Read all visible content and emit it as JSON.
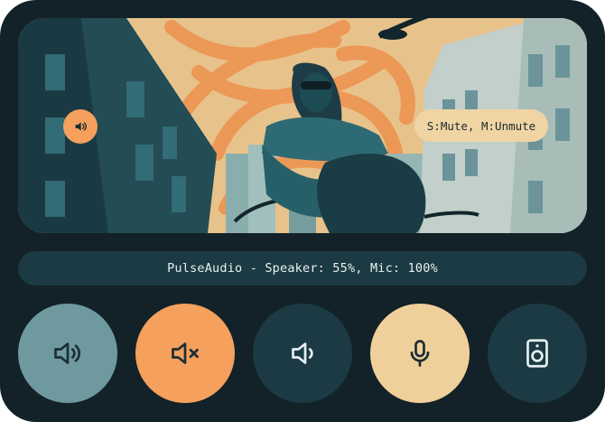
{
  "hero": {
    "hint_text": "S:Mute, M:Unmute",
    "mini_icon": "volume-icon"
  },
  "status": {
    "text": "PulseAudio - Speaker: 55%, Mic: 100%"
  },
  "buttons": [
    {
      "name": "volume-up",
      "icon": "volume-high-icon",
      "color": "#6e9a9f",
      "icon_color": "#1c2e33"
    },
    {
      "name": "mute",
      "icon": "volume-mute-icon",
      "color": "#f5a05d",
      "icon_color": "#1c2e33"
    },
    {
      "name": "volume-down",
      "icon": "volume-low-icon",
      "color": "#1c3a43",
      "icon_color": "#e6eef0"
    },
    {
      "name": "microphone",
      "icon": "microphone-icon",
      "color": "#f0d09a",
      "icon_color": "#1c2e33"
    },
    {
      "name": "speaker",
      "icon": "speaker-icon",
      "color": "#1c3a43",
      "icon_color": "#e6eef0"
    }
  ],
  "colors": {
    "background": "#122228",
    "status_bar": "#1c3a43",
    "accent_orange": "#f5a05d",
    "accent_cream": "#f0d09a",
    "accent_teal": "#6e9a9f"
  }
}
